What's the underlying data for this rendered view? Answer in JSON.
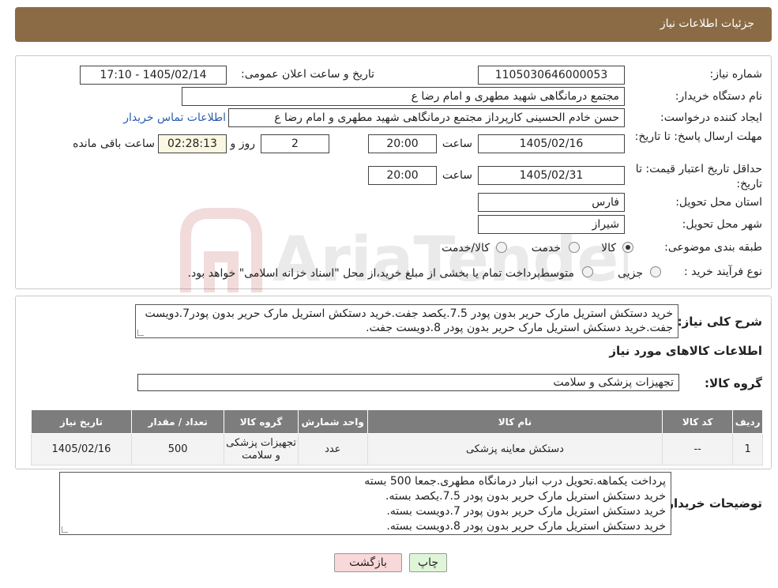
{
  "header": {
    "title": "جزئیات اطلاعات نیاز"
  },
  "info": {
    "need_number_label": "شماره نیاز:",
    "need_number": "1105030646000053",
    "announce_label": "تاریخ و ساعت اعلان عمومی:",
    "announce_value": "1405/02/14 - 17:10",
    "buyer_org_label": "نام دستگاه خریدار:",
    "buyer_org": "مجتمع درمانگاهی شهید مطهری و امام رضا  ع",
    "requester_label": "ایجاد کننده درخواست:",
    "requester": "حسن خادم الحسینی کارپرداز مجتمع درمانگاهی شهید مطهری و امام رضا  ع",
    "contact_link": "اطلاعات تماس خریدار",
    "deadline_label": "مهلت ارسال پاسخ: تا تاریخ:",
    "deadline_date": "1405/02/16",
    "time_label": "ساعت",
    "deadline_time": "20:00",
    "days_value": "2",
    "days_label": "روز و",
    "remaining_time": "02:28:13",
    "remaining_label": "ساعت باقی مانده",
    "validity_label": "حداقل تاریخ اعتبار قیمت: تا تاریخ:",
    "validity_date": "1405/02/31",
    "validity_time": "20:00",
    "province_label": "استان محل تحویل:",
    "province": "فارس",
    "city_label": "شهر محل تحویل:",
    "city": "شیراز",
    "category_label": "طبقه بندی موضوعی:",
    "category_options": [
      "کالا",
      "خدمت",
      "کالا/خدمت"
    ],
    "category_selected": "کالا",
    "process_label": "نوع فرآیند خرید :",
    "process_options": [
      "جزیی",
      "متوسط"
    ],
    "process_note": "پرداخت تمام یا بخشی از مبلغ خرید،از محل \"اسناد خزانه اسلامی\" خواهد بود."
  },
  "summary": {
    "label": "شرح کلی نیاز:",
    "text": "خرید دستکش استریل مارک حریر بدون پودر 7.5.یکصد جفت.خرید دستکش استریل مارک حریر بدون پودر7.دویست جفت.خرید دستکش استریل مارک حریر بدون پودر 8.دویست جفت.",
    "goods_info_title": "اطلاعات کالاهای مورد نیاز",
    "goods_group_label": "گروه کالا:",
    "goods_group": "تجهیزات پزشکی و سلامت"
  },
  "table": {
    "headers": [
      "ردیف",
      "کد کالا",
      "نام کالا",
      "واحد شمارش",
      "گروه کالا",
      "تعداد / مقدار",
      "تاریخ نیاز"
    ],
    "rows": [
      [
        "1",
        "--",
        "دستکش معاینه پزشکی",
        "عدد",
        "تجهیزات پزشکی و سلامت",
        "500",
        "1405/02/16"
      ]
    ]
  },
  "buyer_notes": {
    "label": "توضیحات خریدار:",
    "lines": [
      "پرداخت یکماهه.تحویل درب انبار درمانگاه مطهری.جمعا 500 بسته",
      "خرید دستکش استریل مارک حریر بدون پودر 7.5.یکصد بسته.",
      "خرید دستکش استریل مارک حریر بدون پودر 7.دویست بسته.",
      "خرید دستکش استریل مارک حریر بدون پودر 8.دویست بسته."
    ]
  },
  "buttons": {
    "print": "چاپ",
    "back": "بازگشت"
  },
  "watermark": {
    "text": "AriaTender.neT"
  },
  "colors": {
    "header": "#8b6b45",
    "table_header": "#7d7d7d",
    "link": "#2a5db0",
    "back_button": "#f8d8d8",
    "print_button": "#dff5d8"
  }
}
